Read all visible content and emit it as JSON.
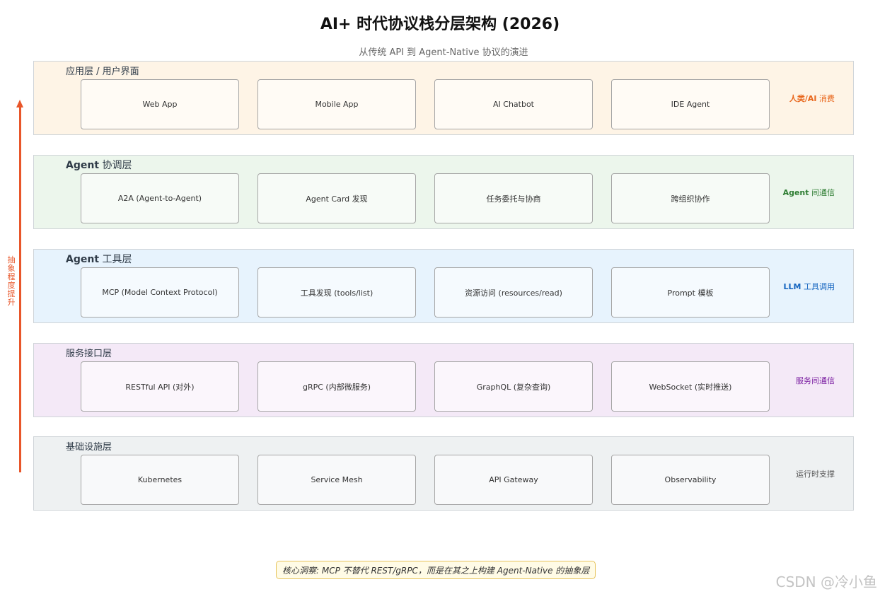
{
  "title": "AI+ 时代协议栈分层架构 (2026)",
  "subtitle": "从传统 API 到 Agent-Native 协议的演进",
  "axis_label": "抽象程度提升",
  "layers": [
    {
      "title": "应用层 / 用户界面",
      "boxes": [
        "Web App",
        "Mobile App",
        "AI Chatbot",
        "IDE Agent"
      ],
      "side_label_en": "人类/AI",
      "side_label_zh": " 消费",
      "bg": "#fef4e6",
      "side_color": "#e8651a"
    },
    {
      "title_en": "Agent",
      "title_zh": " 协调层",
      "boxes": [
        "A2A (Agent-to-Agent)",
        "Agent Card 发现",
        "任务委托与协商",
        "跨组织协作"
      ],
      "side_label_en": "Agent",
      "side_label_zh": " 间通信",
      "bg": "#ecf6ec",
      "side_color": "#2e7d32"
    },
    {
      "title_en": "Agent",
      "title_zh": " 工具层",
      "boxes": [
        "MCP (Model Context Protocol)",
        "工具发现 (tools/list)",
        "资源访问 (resources/read)",
        "Prompt 模板"
      ],
      "side_label_en": "LLM",
      "side_label_zh": " 工具调用",
      "bg": "#e7f3fd",
      "side_color": "#1565c0"
    },
    {
      "title": "服务接口层",
      "boxes": [
        "RESTful API (对外)",
        "gRPC (内部微服务)",
        "GraphQL (复杂查询)",
        "WebSocket (实时推送)"
      ],
      "side_label_zh": "服务间通信",
      "bg": "#f4e9f7",
      "side_color": "#7b1fa2"
    },
    {
      "title": "基础设施层",
      "boxes": [
        "Kubernetes",
        "Service Mesh",
        "API Gateway",
        "Observability"
      ],
      "side_label_zh": "运行时支撑",
      "bg": "#eef1f2",
      "side_color": "#555555"
    }
  ],
  "insight": "核心洞察: MCP 不替代 REST/gRPC，而是在其之上构建 Agent-Native 的抽象层",
  "watermark": "CSDN @冷小鱼",
  "colors": {
    "arrow": "#e8562a",
    "insight_border": "#e6c35a"
  }
}
